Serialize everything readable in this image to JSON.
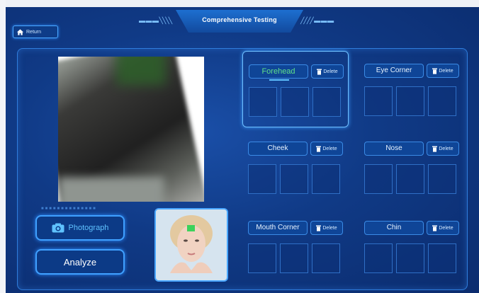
{
  "header": {
    "title": "Comprehensive Testing",
    "return_label": "Return"
  },
  "regions": [
    {
      "name": "Forehead",
      "delete_label": "Delete",
      "selected": true
    },
    {
      "name": "Eye Corner",
      "delete_label": "Delete",
      "selected": false
    },
    {
      "name": "Cheek",
      "delete_label": "Delete",
      "selected": false
    },
    {
      "name": "Nose",
      "delete_label": "Delete",
      "selected": false
    },
    {
      "name": "Mouth Corner",
      "delete_label": "Delete",
      "selected": false
    },
    {
      "name": "Chin",
      "delete_label": "Delete",
      "selected": false
    }
  ],
  "controls": {
    "photograph_label": "Photograph",
    "analyze_label": "Analyze"
  },
  "colors": {
    "accent": "#3fa0ff",
    "active_text": "#5fe08a",
    "background": "#103a86"
  },
  "icons": {
    "return": "home-icon",
    "photograph": "camera-icon",
    "delete": "trash-icon"
  }
}
